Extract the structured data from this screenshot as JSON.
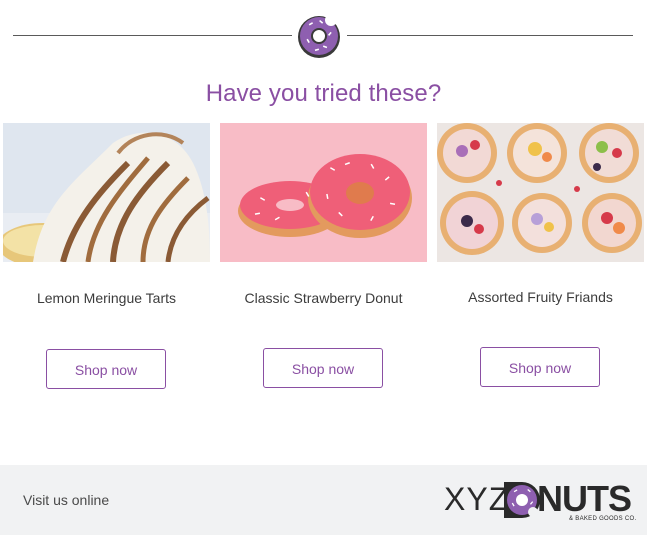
{
  "heading": "Have you tried these?",
  "products": [
    {
      "name": "Lemon Meringue Tarts",
      "cta": "Shop now"
    },
    {
      "name": "Classic Strawberry Donut",
      "cta": "Shop now"
    },
    {
      "name": "Assorted Fruity Friands",
      "cta": "Shop now"
    }
  ],
  "footer": {
    "visit_label": "Visit us online",
    "brand_xyz": "XYZ",
    "brand_nuts": "NUTS",
    "brand_sub": "& BAKED GOODS CO."
  },
  "colors": {
    "accent": "#8a4fa3",
    "donut_purple": "#8e5fb0",
    "footer_bg": "#f1f2f3"
  }
}
